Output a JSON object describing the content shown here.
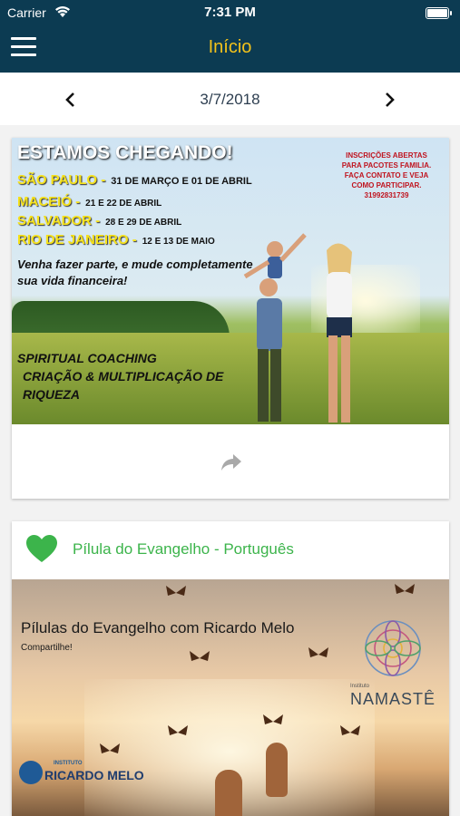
{
  "status_bar": {
    "carrier": "Carrier",
    "time": "7:31 PM",
    "battery_level": 1.0
  },
  "nav": {
    "title": "Início",
    "menu_icon": "hamburger-menu-icon"
  },
  "date_nav": {
    "date": "3/7/2018",
    "prev_icon": "chevron-left-icon",
    "next_icon": "chevron-right-icon"
  },
  "card1": {
    "headline": "ESTAMOS CHEGANDO!",
    "cities": [
      {
        "name": "SÃO PAULO -",
        "dates": "31 DE MARÇO E 01 DE ABRIL"
      },
      {
        "name": "MACEIÓ -",
        "dates": "21 E 22 DE ABRIL"
      },
      {
        "name": "SALVADOR -",
        "dates": "28 E 29 DE ABRIL"
      },
      {
        "name": "RIO DE JANEIRO -",
        "dates": "12 E 13 DE MAIO"
      }
    ],
    "promo": [
      "INSCRIÇÕES ABERTAS",
      "PARA PACOTES FAMILIA.",
      "FAÇA CONTATO E VEJA",
      "COMO PARTICIPAR.",
      "31992831739"
    ],
    "slogan": "Venha fazer parte, e mude completamente sua vida financeira!",
    "coaching": [
      "SPIRITUAL COACHING",
      "CRIAÇÃO & MULTIPLICAÇÃO DE",
      "RIQUEZA"
    ],
    "share_icon": "share-arrow-icon"
  },
  "card2": {
    "title": "Pílula do Evangelho - Português",
    "heart_icon": "heart-icon",
    "heart_color": "#3cb44b",
    "image": {
      "title": "Pílulas do Evangelho com Ricardo Melo",
      "subtitle": "Compartilhe!",
      "namaste_small": "Instituto",
      "namaste_name": "NAMASTÊ",
      "rm_small": "INSTITUTO",
      "rm_name": "RICARDO MELO"
    }
  },
  "colors": {
    "nav_bg": "#0c3b52",
    "nav_title": "#f2c21b",
    "accent_green": "#3cb44b"
  }
}
